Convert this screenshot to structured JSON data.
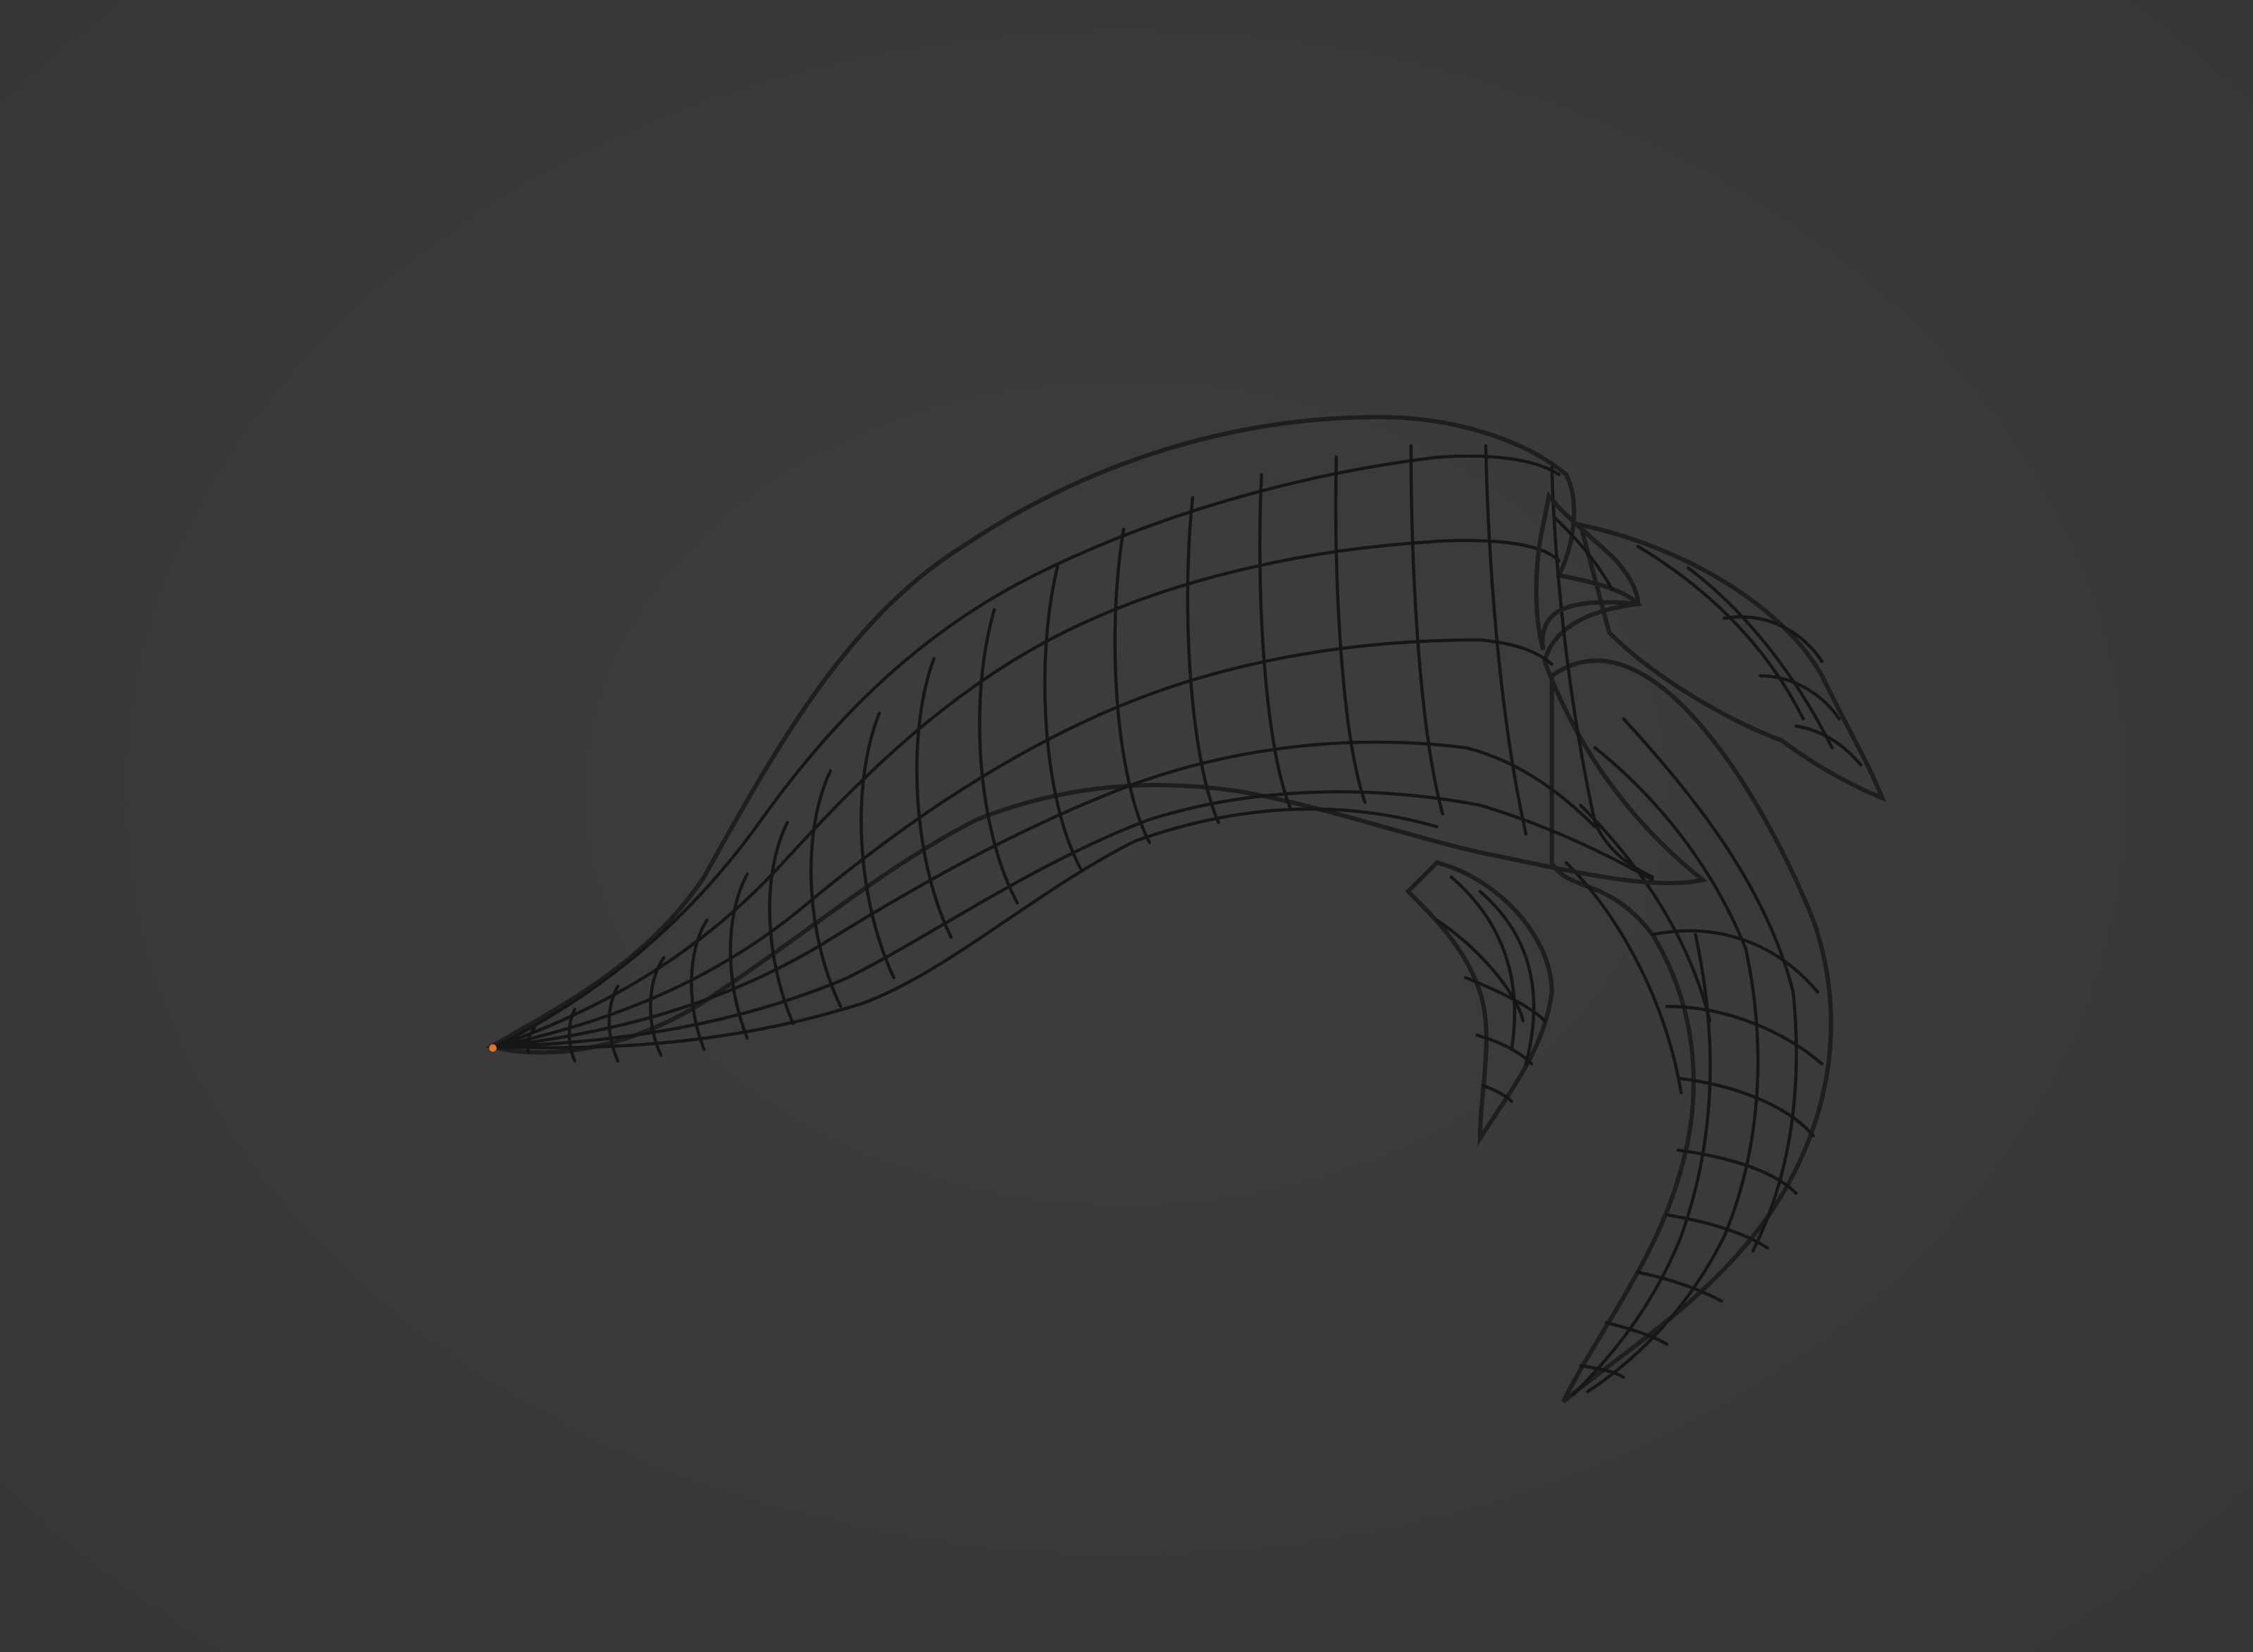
{
  "viewport": {
    "background_color": "#3a3a3a",
    "mesh_color": "#a6a6a6",
    "wire_color": "#161616",
    "selected_vertex_color": "#e0742a"
  },
  "object": {
    "name_icon": "curved-claw-mesh",
    "display_mode": "wireframe-overlay"
  }
}
